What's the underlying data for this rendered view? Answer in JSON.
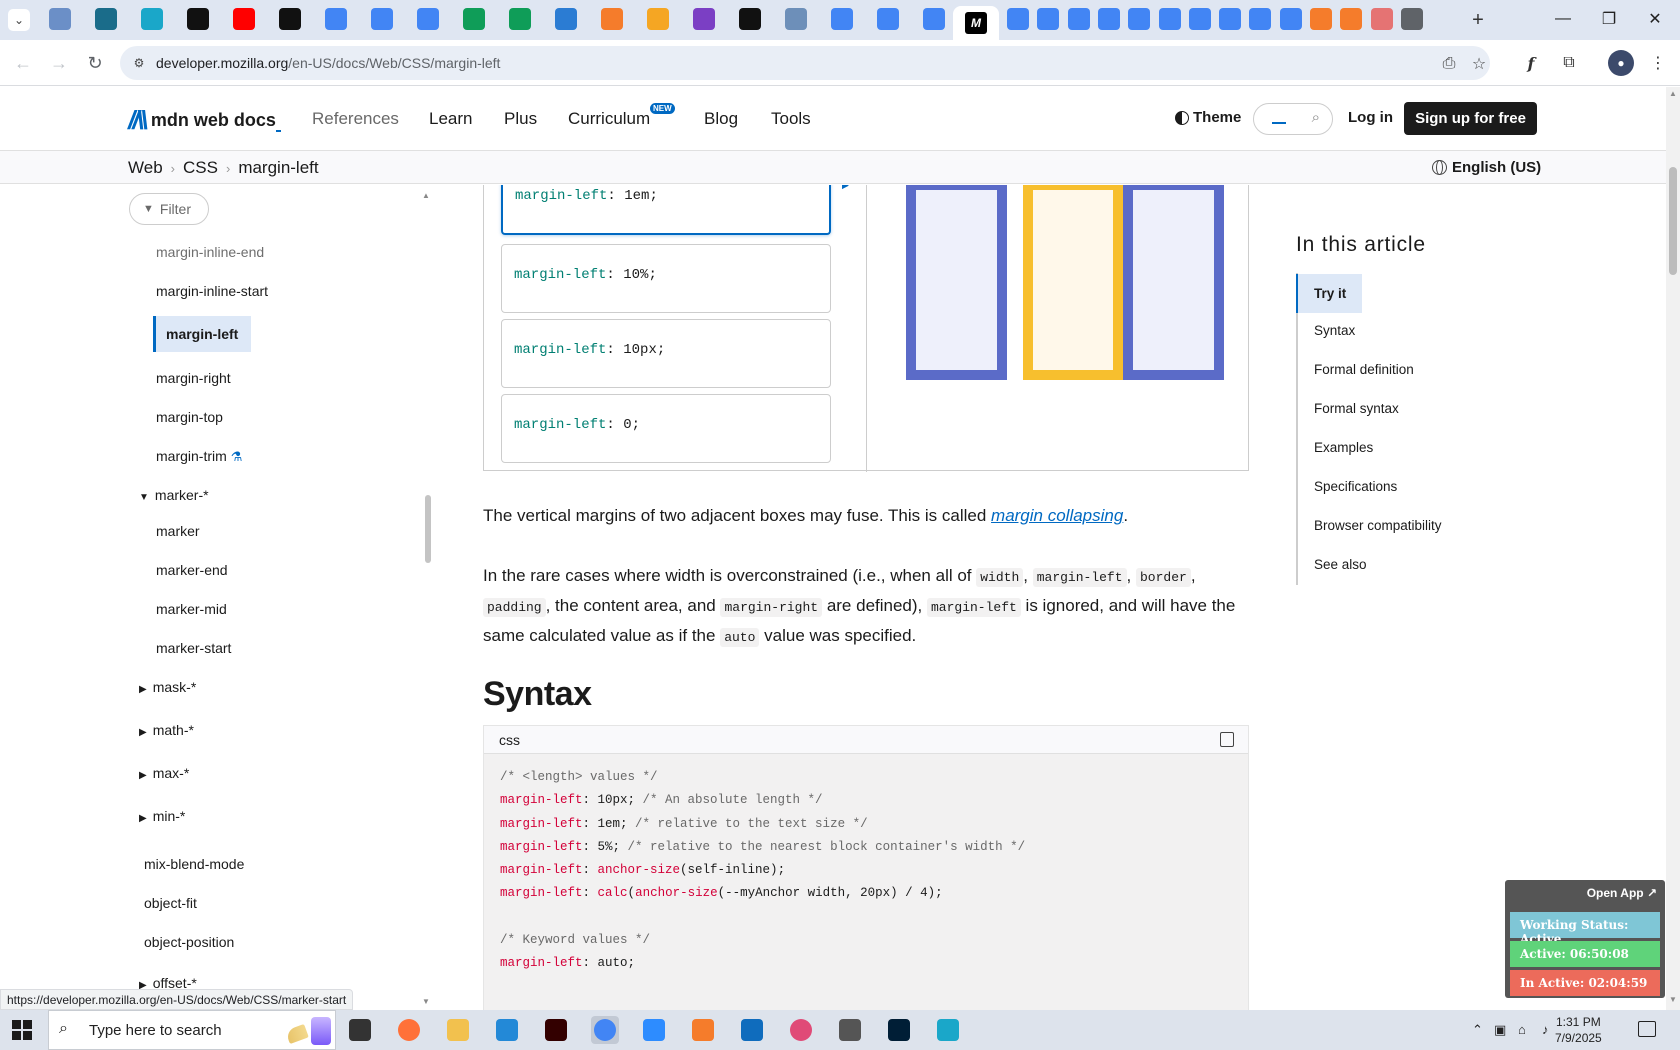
{
  "browser": {
    "url_host": "developer.mozilla.org",
    "url_path": "/en-US/docs/Web/CSS/margin-left",
    "status_link": "https://developer.mozilla.org/en-US/docs/Web/CSS/marker-start",
    "tabs": [
      {
        "icon": "circle-half-icon",
        "color": "#6b8fc7"
      },
      {
        "icon": "triangle-logo-icon",
        "color": "#1a6c8a"
      },
      {
        "icon": "hex-logo-icon",
        "color": "#1aa7c9"
      },
      {
        "icon": "github-icon",
        "color": "#111111"
      },
      {
        "icon": "youtube-icon",
        "color": "#ff0000"
      },
      {
        "icon": "bolt-icon",
        "color": "#111111"
      },
      {
        "icon": "docs-icon",
        "color": "#4285f4"
      },
      {
        "icon": "docs-icon",
        "color": "#4285f4"
      },
      {
        "icon": "docs-icon",
        "color": "#4285f4"
      },
      {
        "icon": "sheets-icon",
        "color": "#0f9d58"
      },
      {
        "icon": "sheets-icon",
        "color": "#0f9d58"
      },
      {
        "icon": "ms-icon",
        "color": "#2b7cd3"
      },
      {
        "icon": "xampp-icon",
        "color": "#f57c2b"
      },
      {
        "icon": "v-logo-icon",
        "color": "#f5a623"
      },
      {
        "icon": "braces-icon",
        "color": "#7b3fc4"
      },
      {
        "icon": "angular-bracket-icon",
        "color": "#111111"
      },
      {
        "icon": "grid-logo-icon",
        "color": "#6d8fb9"
      },
      {
        "icon": "docs-icon",
        "color": "#4285f4"
      },
      {
        "icon": "docs-icon",
        "color": "#4285f4"
      },
      {
        "icon": "docs-icon",
        "color": "#4285f4"
      }
    ],
    "tabs_right": [
      {
        "icon": "docs-icon",
        "color": "#4285f4"
      },
      {
        "icon": "docs-icon",
        "color": "#4285f4"
      },
      {
        "icon": "docs-icon",
        "color": "#4285f4"
      },
      {
        "icon": "docs-icon",
        "color": "#4285f4"
      },
      {
        "icon": "docs-icon",
        "color": "#4285f4"
      },
      {
        "icon": "docs-icon",
        "color": "#4285f4"
      },
      {
        "icon": "docs-icon",
        "color": "#4285f4"
      },
      {
        "icon": "docs-icon",
        "color": "#4285f4"
      },
      {
        "icon": "docs-icon",
        "color": "#4285f4"
      },
      {
        "icon": "docs-icon",
        "color": "#4285f4"
      },
      {
        "icon": "xampp-icon",
        "color": "#f57c2b"
      },
      {
        "icon": "xampp-icon",
        "color": "#f57c2b"
      },
      {
        "icon": "rainbow-icon",
        "color": "#e57373"
      },
      {
        "icon": "chrome-icon",
        "color": "#5f6368"
      }
    ],
    "active_tab_icon": "M"
  },
  "mdn": {
    "logo_text": "mdn web docs",
    "nav": [
      "References",
      "Learn",
      "Plus",
      "Curriculum",
      "Blog",
      "Tools"
    ],
    "new_badge": "NEW",
    "theme_label": "Theme",
    "login": "Log in",
    "signup": "Sign up for free",
    "breadcrumbs": [
      "Web",
      "CSS",
      "margin-left"
    ],
    "language": "English (US)"
  },
  "sidebar": {
    "filter_placeholder": "Filter",
    "items": [
      "margin-inline-end",
      "margin-inline-start",
      "margin-left",
      "margin-right",
      "margin-top",
      "margin-trim",
      "marker-*",
      "marker",
      "marker-end",
      "marker-mid",
      "marker-start",
      "mask-*",
      "math-*",
      "max-*",
      "min-*",
      "mix-blend-mode",
      "object-fit",
      "object-position",
      "offset-*"
    ]
  },
  "tryit": {
    "choices": [
      {
        "prop": "margin-left",
        "value": "1em;"
      },
      {
        "prop": "margin-left",
        "value": "10%;"
      },
      {
        "prop": "margin-left",
        "value": "10px;"
      },
      {
        "prop": "margin-left",
        "value": "0;"
      }
    ],
    "colors": {
      "blue_border": "#5b6bc8",
      "blue_fill": "#eef0fb",
      "yellow_border": "#f7bf2e",
      "yellow_fill": "#fff8ea"
    }
  },
  "content": {
    "para1_before": "The vertical margins of two adjacent boxes may fuse. This is called ",
    "para1_link": "margin collapsing",
    "para1_after": ".",
    "para2": {
      "t1": "In the rare cases where width is overconstrained (i.e., when all of ",
      "c1": "width",
      "t2": ", ",
      "c2": "margin-left",
      "t3": ", ",
      "c3": "border",
      "t4": ",",
      "c4": "padding",
      "t5": ", the content area, and ",
      "c5": "margin-right",
      "t6": " are defined), ",
      "c6": "margin-left",
      "t7": " is ignored, and will have the same calculated value as if the ",
      "c7": "auto",
      "t8": " value was specified."
    },
    "syntax_heading": "Syntax",
    "code_lang": "css",
    "code_lines": [
      {
        "type": "comment",
        "text": "/* <length> values */"
      },
      {
        "type": "decl",
        "prop": "margin-left",
        "value": " 10px; ",
        "comment": "/* An absolute length */"
      },
      {
        "type": "decl",
        "prop": "margin-left",
        "value": " 1em; ",
        "comment": "/* relative to the text size */"
      },
      {
        "type": "decl",
        "prop": "margin-left",
        "value": " 5%; ",
        "comment": "/* relative to the nearest block container's width */"
      },
      {
        "type": "fn",
        "prop": "margin-left",
        "fn": "anchor-size",
        "args": "(self-inline);"
      },
      {
        "type": "fn2",
        "prop": "margin-left",
        "fn": "calc",
        "fn2": "anchor-size",
        "args": "(--myAnchor width, 20px) / 4);"
      },
      {
        "type": "blank"
      },
      {
        "type": "comment",
        "text": "/* Keyword values */"
      },
      {
        "type": "decl",
        "prop": "margin-left",
        "value": " auto;",
        "comment": ""
      }
    ]
  },
  "toc": {
    "title": "In this article",
    "items": [
      "Try it",
      "Syntax",
      "Formal definition",
      "Formal syntax",
      "Examples",
      "Specifications",
      "Browser compatibility",
      "See also"
    ]
  },
  "widget": {
    "open_app": "Open App",
    "working_status": "Working Status: Active",
    "active": "Active: 06:50:08",
    "inactive": "In Active: 02:04:59",
    "colors": {
      "status": "#7fc6d6",
      "active": "#5fd37a",
      "inactive": "#ec6b5b"
    }
  },
  "taskbar": {
    "search_placeholder": "Type here to search",
    "time": "1:31 PM",
    "date": "7/9/2025",
    "apps": [
      {
        "icon": "task-view-icon",
        "color": "#333333"
      },
      {
        "icon": "firefox-icon",
        "color": "#ff7139"
      },
      {
        "icon": "file-explorer-icon",
        "color": "#f2c14e"
      },
      {
        "icon": "vscode-icon",
        "color": "#2389d7"
      },
      {
        "icon": "illustrator-icon",
        "color": "#330000"
      },
      {
        "icon": "chrome-icon",
        "color": "#4285f4"
      },
      {
        "icon": "zoom-icon",
        "color": "#2d8cff"
      },
      {
        "icon": "xampp-icon",
        "color": "#f57c2b"
      },
      {
        "icon": "outlook-icon",
        "color": "#0f6cbd"
      },
      {
        "icon": "creative-cloud-icon",
        "color": "#e04a77"
      },
      {
        "icon": "pen-tool-icon",
        "color": "#555555"
      },
      {
        "icon": "photoshop-icon",
        "color": "#001e36"
      },
      {
        "icon": "hex-app-icon",
        "color": "#1aa7c9"
      }
    ]
  }
}
